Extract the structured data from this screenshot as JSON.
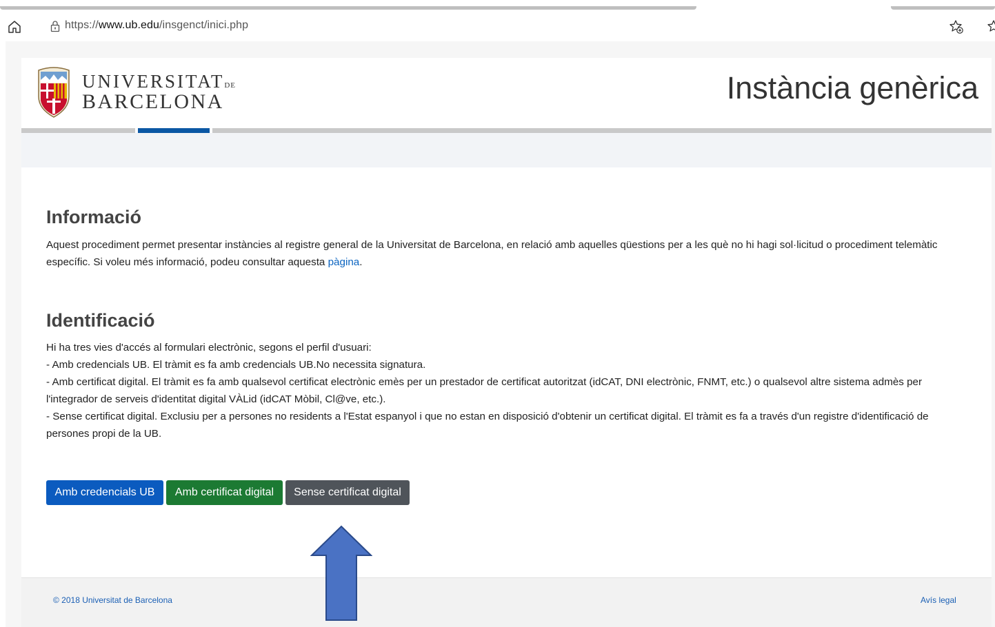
{
  "browser": {
    "url_prefix": "https://",
    "url_domain": "www.ub.edu",
    "url_path": "/insgenct/inici.php"
  },
  "header": {
    "logo_line1_main": "UNIVERSITAT",
    "logo_line1_small": "DE",
    "logo_line2": "BARCELONA",
    "title": "Instància genèrica"
  },
  "info": {
    "heading": "Informació",
    "text_before_link": "Aquest procediment permet presentar instàncies al registre general de la Universitat de Barcelona, en relació amb aquelles qüestions per a les què no hi hagi sol·licitud o procediment telemàtic específic. Si voleu més informació, podeu consultar aquesta ",
    "link": "pàgina",
    "text_after_link": "."
  },
  "identification": {
    "heading": "Identificació",
    "lines": [
      "Hi ha tres vies d'accés al formulari electrònic, segons el perfil d'usuari:",
      "- Amb credencials UB. El tràmit es fa amb credencials UB.No necessita signatura.",
      "- Amb certificat digital. El tràmit es fa amb qualsevol certificat electrònic emès per un prestador de certificat autoritzat (idCAT, DNI electrònic, FNMT, etc.) o qualsevol altre sistema admès per l'integrador de serveis d'identitat digital VÀLid (idCAT Mòbil, Cl@ve, etc.).",
      "- Sense certificat digital. Exclusiu per a persones no residents a l'Estat espanyol i que no estan en disposició d'obtenir un certificat digital. El tràmit es fa a través d'un registre d'identificació de persones propi de la UB."
    ]
  },
  "buttons": {
    "ub_credentials": "Amb credencials UB",
    "digital_certificate": "Amb certificat digital",
    "no_certificate": "Sense certificat digital"
  },
  "footer": {
    "copyright": "© 2018 Universitat de Barcelona",
    "legal": "Avís legal"
  },
  "colors": {
    "btn_blue": "#0b5bbf",
    "btn_green": "#1c7a33",
    "btn_gray": "#4f545a",
    "nav_active": "#0b57a4",
    "annotation_arrow": "#4a72c4"
  }
}
